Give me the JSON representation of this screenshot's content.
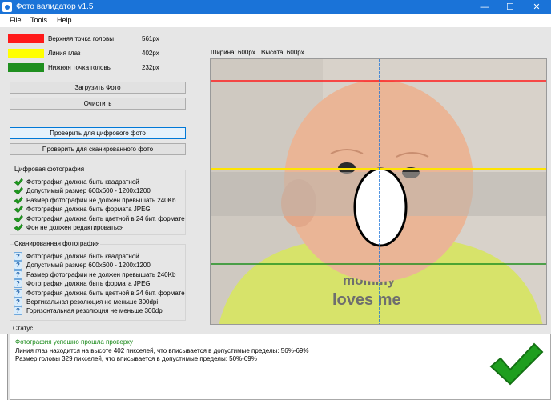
{
  "window": {
    "title": "Фото валидатор v1.5",
    "minimize": "—",
    "maximize": "☐",
    "close": "✕"
  },
  "menu": [
    "File",
    "Tools",
    "Help"
  ],
  "legend": [
    {
      "label": "Верхняя точка головы",
      "value": "561px",
      "color": "#ff1a1a"
    },
    {
      "label": "Линия глаз",
      "value": "402px",
      "color": "#ffff00"
    },
    {
      "label": "Нижняя точка головы",
      "value": "232px",
      "color": "#1f8f1f"
    }
  ],
  "buttons": {
    "load": "Загрузить Фото",
    "clear": "Очистить",
    "check_digital": "Проверить для цифрового фото",
    "check_scanned": "Проверить для сканированного фото"
  },
  "digital": {
    "title": "Цифровая фотография",
    "items": [
      "Фотография должна быть квадратной",
      "Допустимый размер 600x600 - 1200x1200",
      "Размер фотографии не должен превышать 240Kb",
      "Фотография должна быть формата JPEG",
      "Фотография должна быть цветной в 24 бит. формате",
      "Фон не должен редактироваться"
    ]
  },
  "scanned": {
    "title": "Сканированная фотография",
    "items": [
      "Фотография должна быть квадратной",
      "Допустимый размер 600x600 - 1200x1200",
      "Размер фотографии не должен превышать 240Kb",
      "Фотография должна быть формата JPEG",
      "Фотография должна быть цветной в 24 бит. формате",
      "Вертикальная резолюция не меньше 300dpi",
      "Горизонтальная резолюция не меньше 300dpi"
    ]
  },
  "image_info": {
    "width": "Ширина: 600px",
    "height": "Высота: 600px"
  },
  "photo": {
    "shirt_line1": "mommy",
    "shirt_line2": "loves me"
  },
  "status": {
    "label": "Статус",
    "success": "Фотография успешно прошла проверку",
    "line1": "Линия глаз находится на высоте 402 пикселей, что вписывается в допустимые пределы: 56%-69%",
    "line2": "Размер головы 329 пикселей, что вписывается в допустимые пределы: 50%-69%",
    "success_color": "#1a8a1a"
  },
  "colors": {
    "titlebar": "#1a73d8",
    "check": "#1e9e1e",
    "guide": "#1a73d8"
  }
}
